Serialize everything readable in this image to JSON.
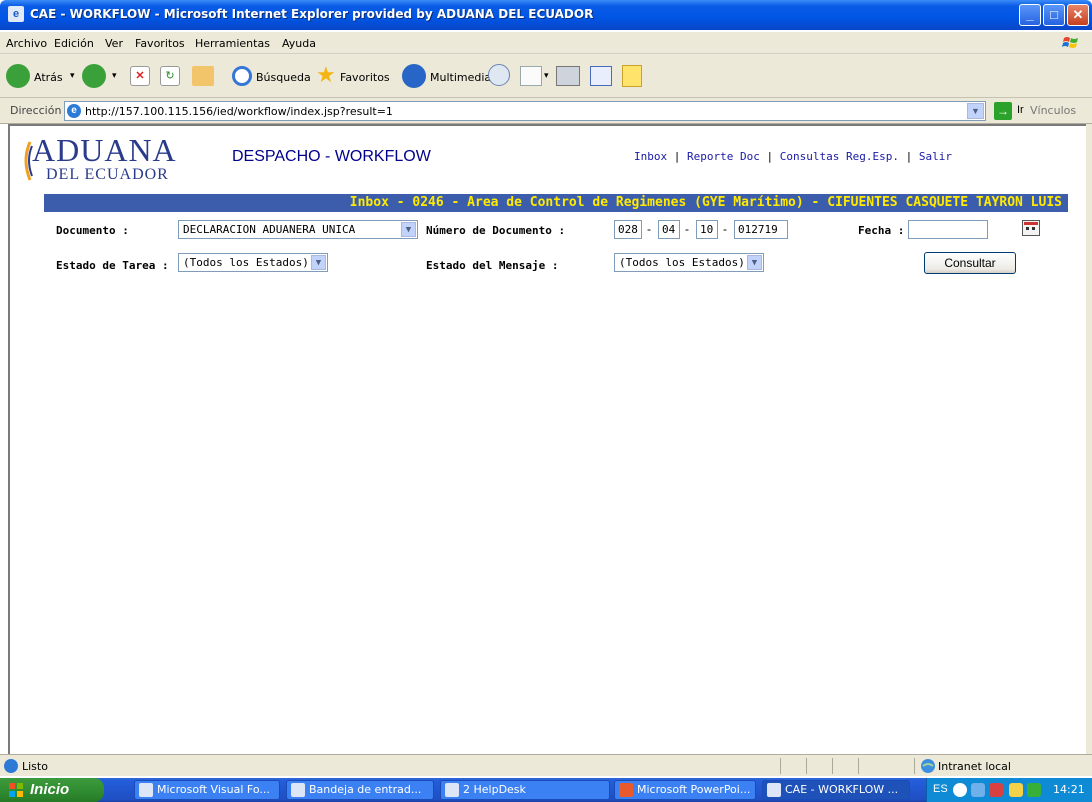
{
  "window": {
    "title": "CAE - WORKFLOW - Microsoft Internet Explorer provided by ADUANA DEL ECUADOR",
    "min": "_",
    "max": "□",
    "close": "✕"
  },
  "menu": [
    "Archivo",
    "Edición",
    "Ver",
    "Favoritos",
    "Herramientas",
    "Ayuda"
  ],
  "toolbar": {
    "back": "Atrás",
    "search": "Búsqueda",
    "favorites": "Favoritos",
    "multimedia": "Multimedia"
  },
  "address": {
    "label": "Dirección",
    "url": "http://157.100.115.156/ied/workflow/index.jsp?result=1",
    "go": "Ir",
    "links": "Vínculos"
  },
  "page": {
    "logo_top": "ADUANA",
    "logo_bottom": "DEL ECUADOR",
    "app_title": "DESPACHO - WORKFLOW",
    "links": [
      "Inbox",
      "Reporte Doc",
      "Consultas Reg.Esp.",
      "Salir"
    ],
    "banner": "Inbox - 0246 - Area de Control de Regimenes (GYE Marítimo) - CIFUENTES CASQUETE TAYRON LUIS",
    "form": {
      "documento_label": "Documento :",
      "documento_value": "DECLARACION ADUANERA UNICA",
      "numero_label": "Número de Documento :",
      "numero_parts": [
        "028",
        "04",
        "10",
        "012719"
      ],
      "fecha_label": "Fecha :",
      "fecha_value": "",
      "estado_tarea_label": "Estado de Tarea :",
      "estado_tarea_value": "(Todos los Estados)",
      "estado_mensaje_label": "Estado del Mensaje :",
      "estado_mensaje_value": "(Todos los Estados)",
      "consultar": "Consultar"
    }
  },
  "status": {
    "text": "Listo",
    "zone": "Intranet local"
  },
  "taskbar": {
    "start": "Inicio",
    "tasks": [
      "Microsoft Visual Fo...",
      "Bandeja de entrad...",
      "2 HelpDesk",
      "Microsoft PowerPoi...",
      "CAE - WORKFLOW ..."
    ],
    "lang": "ES",
    "time": "14:21"
  }
}
